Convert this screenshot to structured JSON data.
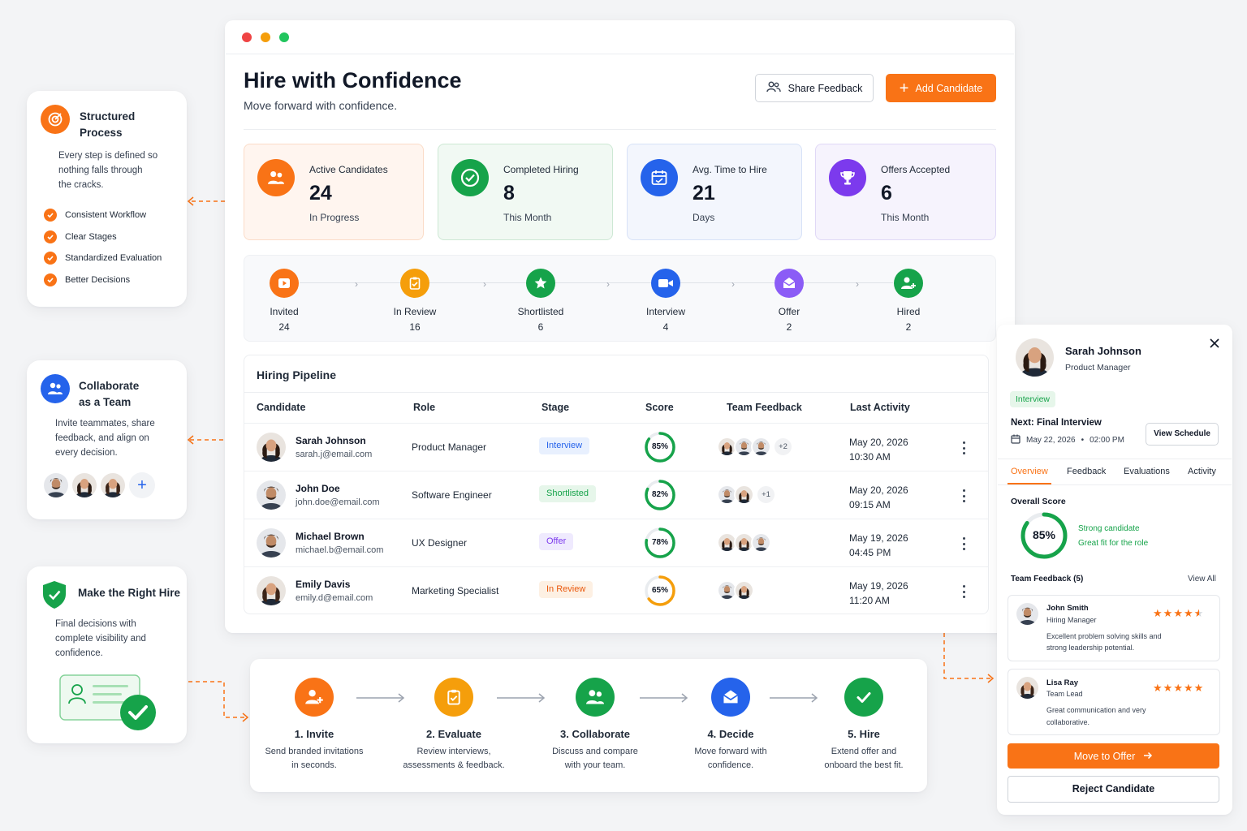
{
  "window": {
    "title": "Hire with Confidence",
    "subtitle": "Move forward with confidence.",
    "share_label": "Share Feedback",
    "add_label": "Add Candidate"
  },
  "stats": [
    {
      "label": "Active Candidates",
      "value": "24",
      "sub": "In Progress",
      "icon": "users-icon",
      "color": "#f97316"
    },
    {
      "label": "Completed Hiring",
      "value": "8",
      "sub": "This Month",
      "icon": "check-circle-icon",
      "color": "#16a34a"
    },
    {
      "label": "Avg. Time to Hire",
      "value": "21",
      "sub": "Days",
      "icon": "calendar-icon",
      "color": "#2563eb"
    },
    {
      "label": "Offers Accepted",
      "value": "6",
      "sub": "This Month",
      "icon": "trophy-icon",
      "color": "#7c3aed"
    }
  ],
  "stages": [
    {
      "name": "Invited",
      "count": "24",
      "icon": "play-icon",
      "color": "#f97316"
    },
    {
      "name": "In Review",
      "count": "16",
      "icon": "clipboard-icon",
      "color": "#f59e0b"
    },
    {
      "name": "Shortlisted",
      "count": "6",
      "icon": "star-icon",
      "color": "#16a34a"
    },
    {
      "name": "Interview",
      "count": "4",
      "icon": "video-icon",
      "color": "#2563eb"
    },
    {
      "name": "Offer",
      "count": "2",
      "icon": "envelope-icon",
      "color": "#8b5cf6"
    },
    {
      "name": "Hired",
      "count": "2",
      "icon": "user-add-icon",
      "color": "#16a34a"
    }
  ],
  "pipeline": {
    "title": "Hiring Pipeline",
    "columns": [
      "Candidate",
      "Role",
      "Stage",
      "Score",
      "Team Feedback",
      "Last Activity"
    ],
    "rows": [
      {
        "name": "Sarah Johnson",
        "email": "sarah.j@email.com",
        "role": "Product Manager",
        "stage": "Interview",
        "stage_bg": "#e8f0fe",
        "stage_fg": "#2563eb",
        "score": "85%",
        "score_value": 0.85,
        "score_color": "#16a34a",
        "feedback_more": "+2",
        "feedback_count": 3,
        "date": "May 20, 2026",
        "time": "10:30 AM"
      },
      {
        "name": "John Doe",
        "email": "john.doe@email.com",
        "role": "Software Engineer",
        "stage": "Shortlisted",
        "stage_bg": "#e6f6ea",
        "stage_fg": "#16a34a",
        "score": "82%",
        "score_value": 0.82,
        "score_color": "#16a34a",
        "feedback_more": "+1",
        "feedback_count": 2,
        "date": "May 20, 2026",
        "time": "09:15 AM"
      },
      {
        "name": "Michael Brown",
        "email": "michael.b@email.com",
        "role": "UX Designer",
        "stage": "Offer",
        "stage_bg": "#efeafe",
        "stage_fg": "#7c3aed",
        "score": "78%",
        "score_value": 0.78,
        "score_color": "#16a34a",
        "feedback_more": "",
        "feedback_count": 3,
        "date": "May 19, 2026",
        "time": "04:45 PM"
      },
      {
        "name": "Emily Davis",
        "email": "emily.d@email.com",
        "role": "Marketing Specialist",
        "stage": "In Review",
        "stage_bg": "#fdf0e3",
        "stage_fg": "#ea580c",
        "score": "65%",
        "score_value": 0.65,
        "score_color": "#f59e0b",
        "feedback_more": "",
        "feedback_count": 2,
        "date": "May 19, 2026",
        "time": "11:20 AM"
      }
    ]
  },
  "left_cards": {
    "structured": {
      "title_1": "Structured",
      "title_2": "Process",
      "desc_1": "Every step is defined so",
      "desc_2": "nothing falls through",
      "desc_3": "the cracks.",
      "items": [
        "Consistent Workflow",
        "Clear Stages",
        "Standardized Evaluation",
        "Better Decisions"
      ]
    },
    "collaborate": {
      "title_1": "Collaborate",
      "title_2": "as a Team",
      "desc_1": "Invite teammates, share",
      "desc_2": "feedback, and align on",
      "desc_3": "every decision."
    },
    "hire": {
      "title": "Make the Right Hire",
      "desc_1": "Final decisions with",
      "desc_2": "complete visibility and",
      "desc_3": "confidence."
    }
  },
  "steps": [
    {
      "title": "1. Invite",
      "d1": "Send branded invitations",
      "d2": "in seconds.",
      "icon": "user-add-icon",
      "color": "#f97316"
    },
    {
      "title": "2. Evaluate",
      "d1": "Review interviews,",
      "d2": "assessments & feedback.",
      "icon": "clipboard-icon",
      "color": "#f59e0b"
    },
    {
      "title": "3. Collaborate",
      "d1": "Discuss and compare",
      "d2": "with your team.",
      "icon": "users-icon",
      "color": "#16a34a"
    },
    {
      "title": "4. Decide",
      "d1": "Move forward with",
      "d2": "confidence.",
      "icon": "envelope-icon",
      "color": "#2563eb"
    },
    {
      "title": "5. Hire",
      "d1": "Extend offer and",
      "d2": "onboard the best fit.",
      "icon": "check-icon",
      "color": "#16a34a"
    }
  ],
  "panel": {
    "name": "Sarah Johnson",
    "title": "Product Manager",
    "stage": "Interview",
    "next": "Next: Final Interview",
    "date": "May 22, 2026",
    "dot": "•",
    "time": "02:00 PM",
    "schedule_label": "View Schedule",
    "tabs": [
      "Overview",
      "Feedback",
      "Evaluations",
      "Activity"
    ],
    "overall_label": "Overall Score",
    "score": "85%",
    "score_value": 0.85,
    "score_l1": "Strong candidate",
    "score_l2": "Great fit for the role",
    "feedback_title": "Team Feedback (5)",
    "view_all": "View All",
    "feedback": [
      {
        "name": "John Smith",
        "role": "Hiring Manager",
        "rating": 4.5,
        "t1": "Excellent problem solving skills and",
        "t2": "strong leadership potential."
      },
      {
        "name": "Lisa Ray",
        "role": "Team Lead",
        "rating": 5,
        "t1": "Great communication and very",
        "t2": "collaborative."
      }
    ],
    "move_label": "Move to Offer",
    "reject_label": "Reject Candidate"
  }
}
